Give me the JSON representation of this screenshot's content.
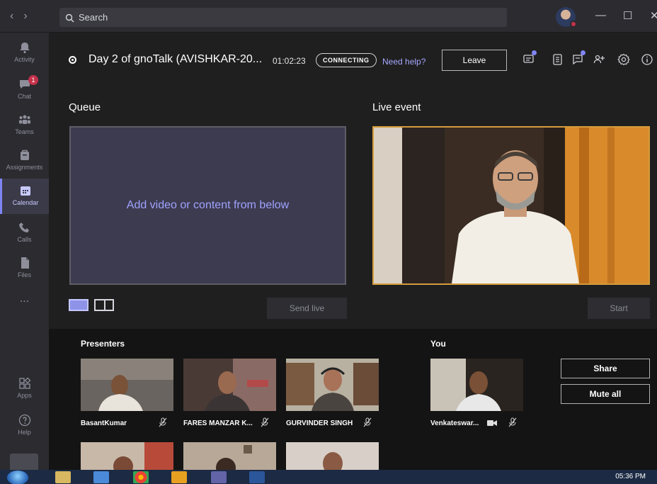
{
  "titlebar": {
    "search_placeholder": "Search",
    "nav_back": "‹",
    "nav_forward": "›",
    "minimize": "—",
    "maximize": "☐",
    "close": "✕"
  },
  "rail": {
    "items": [
      {
        "label": "Activity",
        "icon": "bell-icon"
      },
      {
        "label": "Chat",
        "icon": "chat-icon",
        "badge": "1"
      },
      {
        "label": "Teams",
        "icon": "teams-icon"
      },
      {
        "label": "Assignments",
        "icon": "assignments-icon"
      },
      {
        "label": "Calendar",
        "icon": "calendar-icon",
        "active": true
      },
      {
        "label": "Calls",
        "icon": "phone-icon"
      },
      {
        "label": "Files",
        "icon": "file-icon"
      },
      {
        "label": "...",
        "icon": "more-icon"
      },
      {
        "label": "Apps",
        "icon": "apps-icon"
      },
      {
        "label": "Help",
        "icon": "help-icon"
      }
    ]
  },
  "meeting": {
    "title": "Day 2 of gnoTalk (AVISHKAR-20...",
    "timer": "01:02:23",
    "status": "CONNECTING",
    "need_help": "Need help?",
    "leave_label": "Leave"
  },
  "stage": {
    "queue_label": "Queue",
    "queue_placeholder": "Add video or content from below",
    "live_label": "Live event",
    "send_live_label": "Send live",
    "start_label": "Start"
  },
  "bottom": {
    "presenters_label": "Presenters",
    "you_label": "You",
    "presenters": [
      {
        "name": "BasantKumar"
      },
      {
        "name": "FARES MANZAR K..."
      },
      {
        "name": "GURVINDER SINGH"
      }
    ],
    "you": {
      "name": "Venkateswar..."
    },
    "share_label": "Share",
    "mute_all_label": "Mute all"
  },
  "taskbar": {
    "clock": "05:36 PM"
  },
  "colors": {
    "accent": "#7f85f5",
    "live_border": "#d59b3c",
    "badge": "#c4314b"
  }
}
